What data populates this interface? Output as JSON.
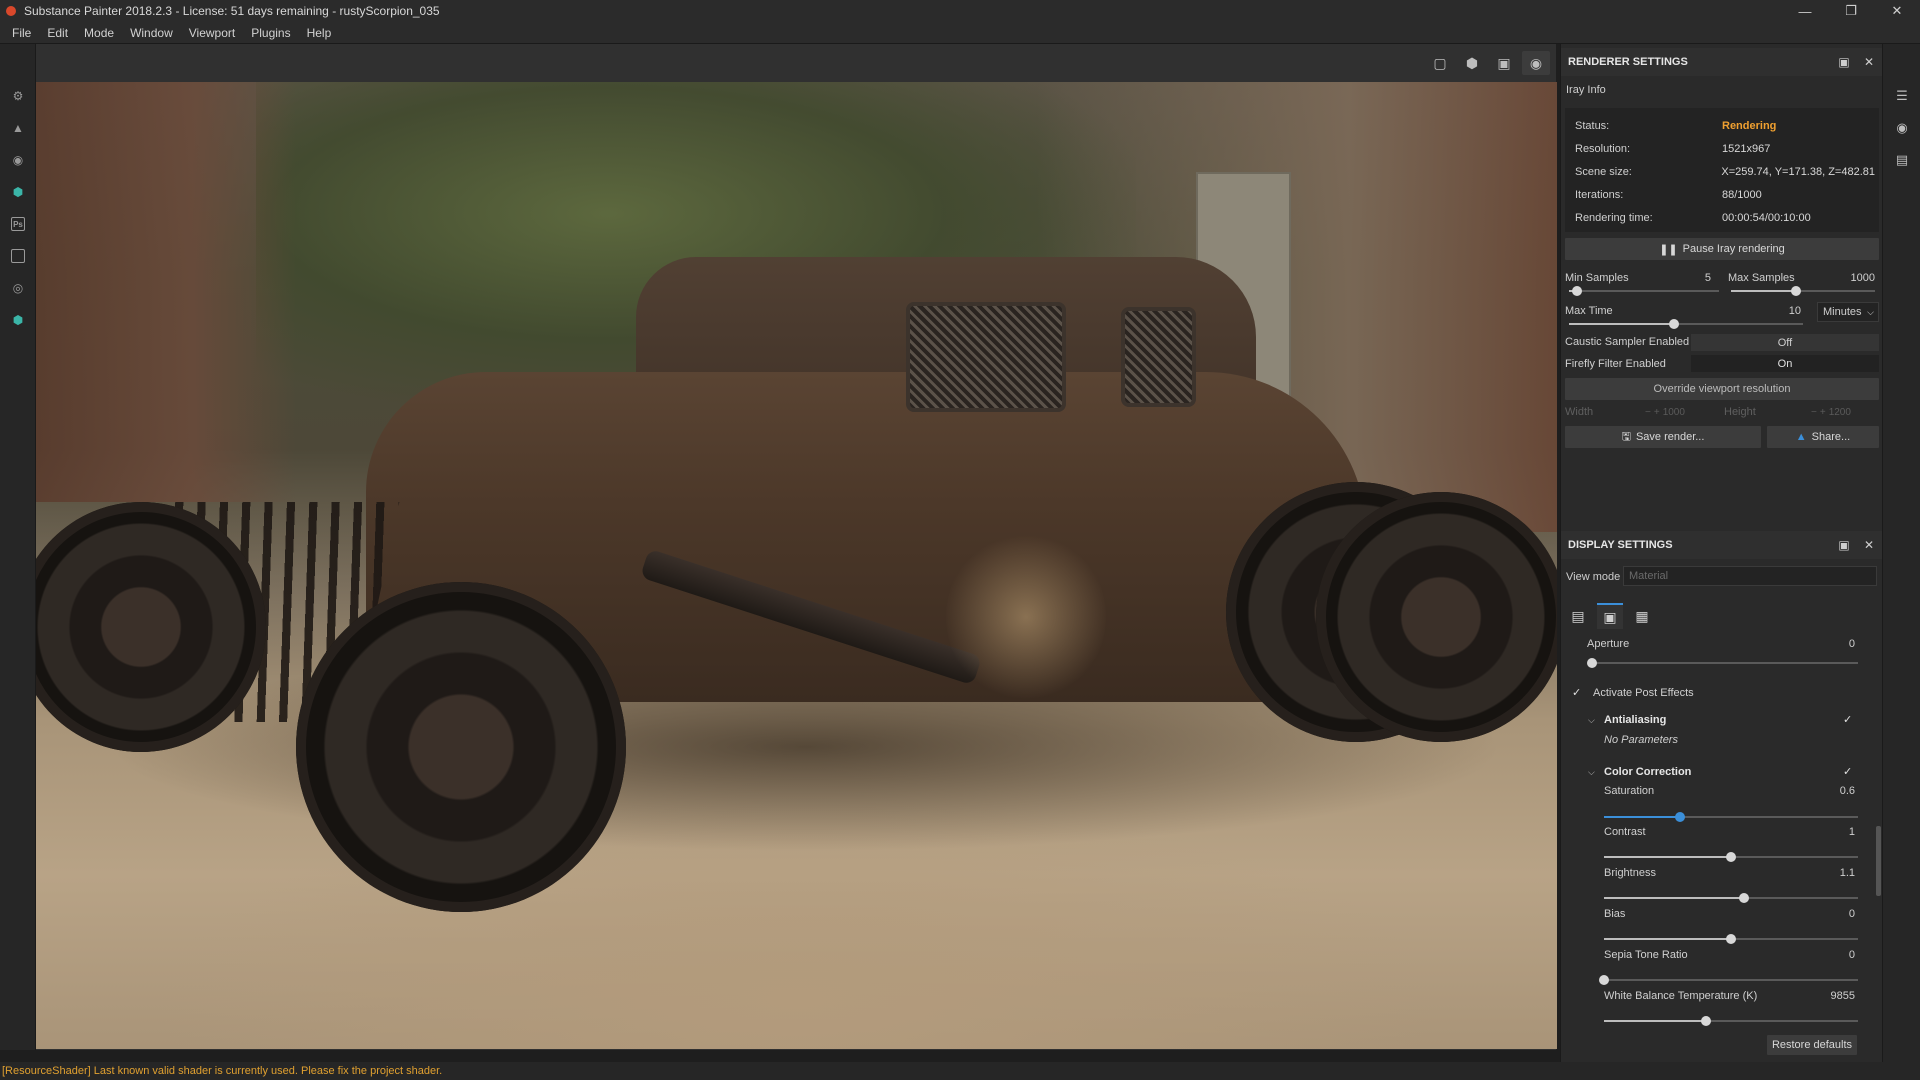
{
  "window": {
    "title": "Substance Painter 2018.2.3 - License: 51 days remaining - rustyScorpion_035",
    "controls": [
      "minimize",
      "restore",
      "close"
    ]
  },
  "menu": [
    "File",
    "Edit",
    "Mode",
    "Window",
    "Viewport",
    "Plugins",
    "Help"
  ],
  "left_toolbar": {
    "icons": [
      "settings-icon",
      "bucket-icon",
      "gear-small-icon",
      "substance-share-icon",
      "photoshop-icon",
      "document-icon",
      "globe-icon",
      "substance-source-icon"
    ],
    "ps_label": "Ps"
  },
  "viewport_toolbar": {
    "icons": [
      "frame-icon",
      "cube-view-icon",
      "camera-icon",
      "screenshot-icon"
    ]
  },
  "renderer_settings": {
    "title": "RENDERER SETTINGS",
    "iray_info_label": "Iray Info",
    "status_label": "Status:",
    "status_value": "Rendering",
    "resolution_label": "Resolution:",
    "resolution_value": "1521x967",
    "scene_size_label": "Scene size:",
    "scene_size_value": "X=259.74, Y=171.38, Z=482.81",
    "iterations_label": "Iterations:",
    "iterations_value": "88/1000",
    "render_time_label": "Rendering time:",
    "render_time_value": "00:00:54/00:10:00",
    "pause_button": "Pause Iray rendering",
    "min_samples_label": "Min Samples",
    "min_samples_value": "5",
    "max_samples_label": "Max Samples",
    "max_samples_value": "1000",
    "max_time_label": "Max Time",
    "max_time_value": "10",
    "max_time_unit": "Minutes",
    "caustic_label": "Caustic Sampler Enabled",
    "caustic_value": "Off",
    "firefly_label": "Firefly Filter Enabled",
    "firefly_value": "On",
    "override_button": "Override viewport resolution",
    "width_label": "Width",
    "width_value": "1000",
    "height_label": "Height",
    "height_value": "1200",
    "save_button": "Save render...",
    "share_button": "Share..."
  },
  "display_settings": {
    "title": "DISPLAY SETTINGS",
    "view_mode_label": "View mode",
    "view_mode_placeholder": "Material",
    "tabs": [
      "image-icon",
      "camera-icon",
      "frame-icon"
    ],
    "aperture_label": "Aperture",
    "aperture_value": "0",
    "activate_post_label": "Activate Post Effects",
    "antialiasing_label": "Antialiasing",
    "antialiasing_note": "No Parameters",
    "color_correction_label": "Color Correction",
    "saturation_label": "Saturation",
    "saturation_value": "0.6",
    "contrast_label": "Contrast",
    "contrast_value": "1",
    "brightness_label": "Brightness",
    "brightness_value": "1.1",
    "bias_label": "Bias",
    "bias_value": "0",
    "sepia_label": "Sepia Tone Ratio",
    "sepia_value": "0",
    "white_balance_label": "White Balance Temperature (K)",
    "white_balance_value": "9855",
    "restore_button": "Restore defaults",
    "slider_levels": {
      "min_samples": 0.05,
      "max_samples": 0.45,
      "max_time": 0.45,
      "aperture": 0.0,
      "saturation": 0.3,
      "contrast": 0.5,
      "brightness": 0.55,
      "bias": 0.5,
      "sepia": 0.0,
      "white_balance": 0.4
    }
  },
  "right_dock_icons": [
    "layers-icon",
    "texture-set-icon",
    "properties-icon"
  ],
  "status_bar": {
    "message": "[ResourceShader] Last known valid shader is currently used. Please fix the project shader."
  },
  "colors": {
    "accent_blue": "#3b8fd9",
    "status_orange": "#f0a030",
    "panel_bg": "#2a2a2a"
  }
}
